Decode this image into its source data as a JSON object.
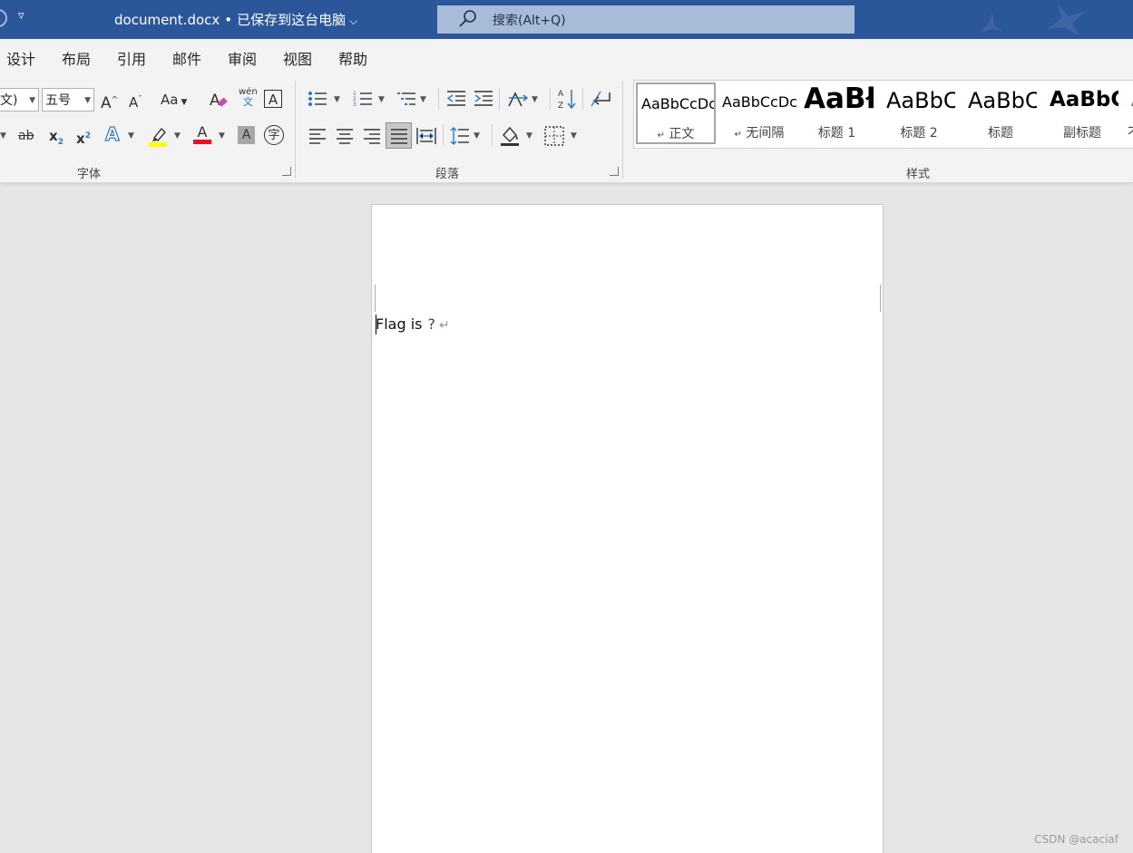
{
  "titlebar": {
    "quick_access_more": "▿",
    "filename": "document.docx",
    "separator": "•",
    "save_status": "已保存到这台电脑",
    "chevron": "⌵",
    "search_placeholder": "搜索(Alt+Q)",
    "bg_color": "#2b579a"
  },
  "menu": {
    "items": [
      "设计",
      "布局",
      "引用",
      "邮件",
      "审阅",
      "视图",
      "帮助"
    ]
  },
  "ribbon": {
    "font_group": {
      "label": "字体",
      "font_name_value": "文)",
      "font_size_value": "五号",
      "change_case": "Aa",
      "pinyin_top": "wén",
      "pinyin_bottom": "文",
      "char_border": "A",
      "strikethrough": "ab",
      "subscript": "x",
      "subscript_sub": "2",
      "superscript": "x",
      "superscript_sup": "2",
      "text_effects": "A",
      "font_color": "A",
      "char_shading": "A",
      "enclose_char": "字",
      "highlight_color": "#ffff00",
      "font_color_bar": "#e81123"
    },
    "paragraph_group": {
      "label": "段落"
    },
    "styles_group": {
      "label": "样式",
      "styles": [
        {
          "preview": "AaBbCcDc",
          "name": "正文",
          "mark": "↵"
        },
        {
          "preview": "AaBbCcDc",
          "name": "无间隔",
          "mark": "↵"
        },
        {
          "preview": "AaBł",
          "name": "标题 1"
        },
        {
          "preview": "AaBbC",
          "name": "标题 2"
        },
        {
          "preview": "AaBbC",
          "name": "标题"
        },
        {
          "preview": "AaBbC",
          "name": "副标题"
        },
        {
          "preview": "A",
          "name": "不"
        }
      ]
    }
  },
  "document": {
    "text": "Flag is",
    "trailing_char": "?",
    "paragraph_mark": "↵"
  },
  "watermark": "CSDN @acaciaf"
}
